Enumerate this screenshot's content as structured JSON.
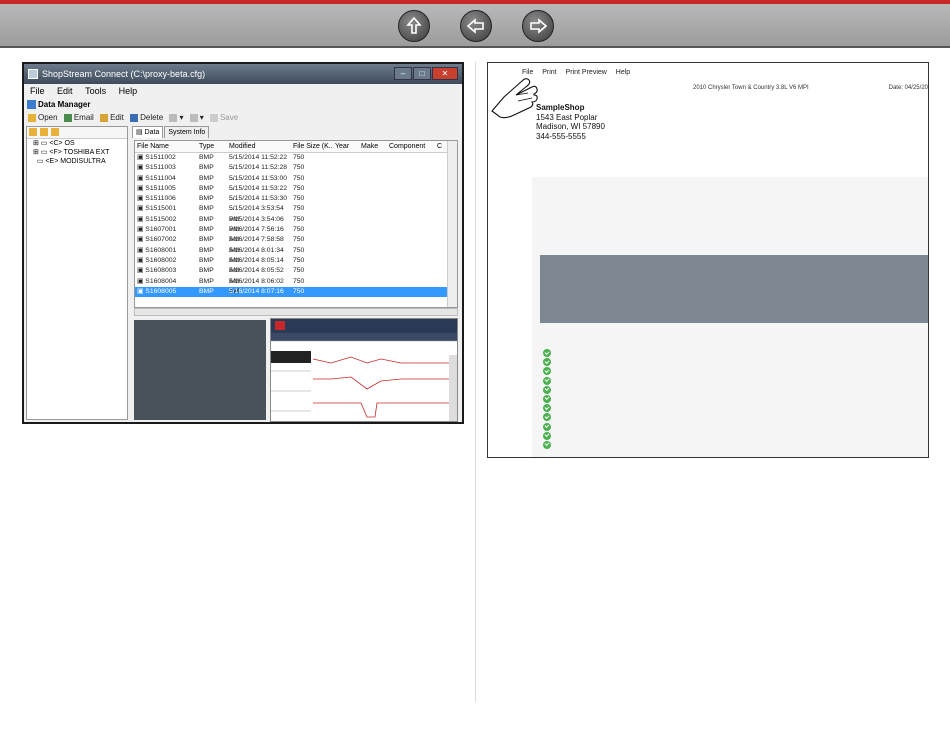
{
  "nav": {
    "icons": [
      "up-arrow-icon",
      "back-arrow-icon",
      "forward-arrow-icon"
    ]
  },
  "window": {
    "title": "ShopStream Connect (C:\\proxy-beta.cfg)",
    "menu": [
      "File",
      "Edit",
      "Tools",
      "Help"
    ],
    "section": "Data Manager",
    "toolbar": {
      "open": "Open",
      "email": "Email",
      "edit": "Edit",
      "delete": "Delete",
      "save": "Save"
    },
    "tree": [
      "<C> OS",
      "<F> TOSHIBA EXT",
      "<E> MODISULTRA"
    ],
    "tabs": [
      "Data",
      "System Info"
    ],
    "columns": [
      "File Name",
      "Type",
      "Modified",
      "File Size (K..",
      "Year",
      "Make",
      "Component",
      "C"
    ],
    "rows": [
      [
        "S1511002",
        "BMP",
        "5/15/2014 11:52:22 ...",
        "750"
      ],
      [
        "S1511003",
        "BMP",
        "5/15/2014 11:52:28 ...",
        "750"
      ],
      [
        "S1511004",
        "BMP",
        "5/15/2014 11:53:00 ...",
        "750"
      ],
      [
        "S1511005",
        "BMP",
        "5/15/2014 11:53:22 ...",
        "750"
      ],
      [
        "S1511006",
        "BMP",
        "5/15/2014 11:53:30 ...",
        "750"
      ],
      [
        "S1515001",
        "BMP",
        "5/15/2014 3:53:54 PM",
        "750"
      ],
      [
        "S1515002",
        "BMP",
        "5/15/2014 3:54:06 PM",
        "750"
      ],
      [
        "S1607001",
        "BMP",
        "5/16/2014 7:56:16 AM",
        "750"
      ],
      [
        "S1607002",
        "BMP",
        "5/16/2014 7:58:58 AM",
        "750"
      ],
      [
        "S1608001",
        "BMP",
        "5/16/2014 8:01:34 AM",
        "750"
      ],
      [
        "S1608002",
        "BMP",
        "5/16/2014 8:05:14 AM",
        "750"
      ],
      [
        "S1608003",
        "BMP",
        "5/16/2014 8:05:52 AM",
        "750"
      ],
      [
        "S1608004",
        "BMP",
        "5/16/2014 8:06:02 AM",
        "750"
      ],
      [
        "S1608005",
        "BMP",
        "5/16/2014 8:07:16 AM",
        "750"
      ]
    ]
  },
  "report": {
    "menu": [
      "File",
      "Print",
      "Print Preview",
      "Help"
    ],
    "vehicle": "2010 Chrysler Town & Country 3.8L V6 MPI",
    "date": "Date: 04/25/20",
    "shop_name": "SampleShop",
    "address1": "1543 East Poplar",
    "address2": "Madison, WI 57890",
    "phone": "344-555-5555",
    "check_count": 11
  },
  "colors": {
    "accent_red": "#c62828",
    "selection": "#3399ff",
    "report_band": "#7c8792",
    "check_green": "#4caf50"
  }
}
